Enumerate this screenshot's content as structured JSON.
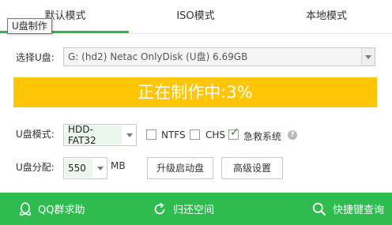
{
  "tabs": [
    {
      "label": "默认模式",
      "active": true
    },
    {
      "label": "ISO模式",
      "active": false
    },
    {
      "label": "本地模式",
      "active": false
    }
  ],
  "tooltip": "U盘制作",
  "select_disk": {
    "label": "选择U盘:",
    "value": "G: (hd2) Netac OnlyDisk  (U盘) 6.69GB"
  },
  "progress": {
    "text": "正在制作中:3%",
    "fraction": 1.0,
    "fill_color": "#fec607"
  },
  "mode": {
    "label": "U盘模式:",
    "selected": "HDD-FAT32"
  },
  "options": [
    {
      "label": "NTFS",
      "checked": false
    },
    {
      "label": "CHS",
      "checked": false
    },
    {
      "label": "急救系统",
      "checked": true
    }
  ],
  "partition": {
    "label": "U盘分配:",
    "value": "550",
    "unit": "MB"
  },
  "buttons": {
    "upgrade": "升级启动盘",
    "advanced": "高级设置"
  },
  "footer": {
    "qq": "QQ群求助",
    "restore": "归还空间",
    "shortcut": "快捷键查询"
  },
  "colors": {
    "accent_green": "#2ebc4f",
    "progress_yellow": "#fec607"
  }
}
